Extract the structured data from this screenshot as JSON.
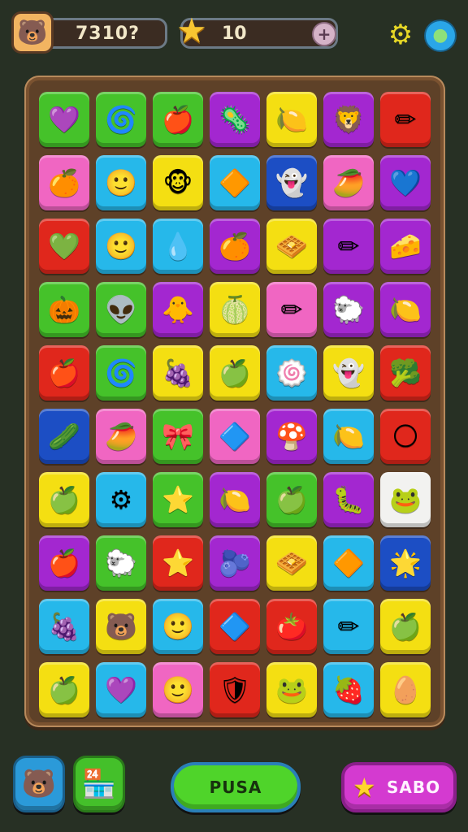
{
  "hud": {
    "score": "7310?",
    "stars": "10",
    "plus_label": "+",
    "avatar_icon": "bear-face-icon",
    "star_icon": "star-icon",
    "gear_icon": "gear-icon",
    "globe_icon": "globe-icon"
  },
  "board": {
    "rows": [
      [
        {
          "color": "green",
          "glyph": "💜"
        },
        {
          "color": "green",
          "glyph": "🌀"
        },
        {
          "color": "green",
          "glyph": "🍎"
        },
        {
          "color": "purple",
          "glyph": "🦠"
        },
        {
          "color": "yellow",
          "glyph": "🍋"
        },
        {
          "color": "purple",
          "glyph": "🦁"
        },
        {
          "color": "red",
          "glyph": "✏"
        }
      ],
      [
        {
          "color": "pink",
          "glyph": "🍊"
        },
        {
          "color": "cyan",
          "glyph": "🙂"
        },
        {
          "color": "yellow",
          "glyph": "🐵"
        },
        {
          "color": "cyan",
          "glyph": "🔶"
        },
        {
          "color": "blue",
          "glyph": "👻"
        },
        {
          "color": "pink",
          "glyph": "🥭"
        },
        {
          "color": "purple",
          "glyph": "💙"
        }
      ],
      [
        {
          "color": "red",
          "glyph": "💚"
        },
        {
          "color": "cyan",
          "glyph": "🙂"
        },
        {
          "color": "cyan",
          "glyph": "💧"
        },
        {
          "color": "purple",
          "glyph": "🍊"
        },
        {
          "color": "yellow",
          "glyph": "🧇"
        },
        {
          "color": "purple",
          "glyph": "✏"
        },
        {
          "color": "purple",
          "glyph": "🧀"
        }
      ],
      [
        {
          "color": "green",
          "glyph": "🎃"
        },
        {
          "color": "green",
          "glyph": "👽"
        },
        {
          "color": "purple",
          "glyph": "🐥"
        },
        {
          "color": "yellow",
          "glyph": "🍈"
        },
        {
          "color": "pink",
          "glyph": "✏"
        },
        {
          "color": "purple",
          "glyph": "🐑"
        },
        {
          "color": "purple",
          "glyph": "🍋"
        }
      ],
      [
        {
          "color": "red",
          "glyph": "🍎"
        },
        {
          "color": "green",
          "glyph": "🌀"
        },
        {
          "color": "yellow",
          "glyph": "🍇"
        },
        {
          "color": "yellow",
          "glyph": "🍏"
        },
        {
          "color": "cyan",
          "glyph": "🍥"
        },
        {
          "color": "yellow",
          "glyph": "👻"
        },
        {
          "color": "red",
          "glyph": "🥦"
        }
      ],
      [
        {
          "color": "blue",
          "glyph": "🥒"
        },
        {
          "color": "pink",
          "glyph": "🥭"
        },
        {
          "color": "green",
          "glyph": "🎀"
        },
        {
          "color": "pink",
          "glyph": "🔷"
        },
        {
          "color": "purple",
          "glyph": "🍄"
        },
        {
          "color": "cyan",
          "glyph": "🍋"
        },
        {
          "color": "red",
          "glyph": "🌕"
        }
      ],
      [
        {
          "color": "yellow",
          "glyph": "🍏"
        },
        {
          "color": "cyan",
          "glyph": "⚙"
        },
        {
          "color": "green",
          "glyph": "⭐"
        },
        {
          "color": "purple",
          "glyph": "🍋"
        },
        {
          "color": "green",
          "glyph": "🍏"
        },
        {
          "color": "purple",
          "glyph": "🐛"
        },
        {
          "color": "white",
          "glyph": "🐸"
        }
      ],
      [
        {
          "color": "purple",
          "glyph": "🍎"
        },
        {
          "color": "green",
          "glyph": "🐑"
        },
        {
          "color": "red",
          "glyph": "⭐"
        },
        {
          "color": "purple",
          "glyph": "🫐"
        },
        {
          "color": "yellow",
          "glyph": "🧇"
        },
        {
          "color": "cyan",
          "glyph": "🔶"
        },
        {
          "color": "blue",
          "glyph": "🌟"
        }
      ],
      [
        {
          "color": "cyan",
          "glyph": "🍇"
        },
        {
          "color": "yellow",
          "glyph": "🐻"
        },
        {
          "color": "cyan",
          "glyph": "🙂"
        },
        {
          "color": "red",
          "glyph": "🔷"
        },
        {
          "color": "red",
          "glyph": "🍅"
        },
        {
          "color": "cyan",
          "glyph": "✏"
        },
        {
          "color": "yellow",
          "glyph": "🍏"
        }
      ],
      [
        {
          "color": "yellow",
          "glyph": "🍏"
        },
        {
          "color": "cyan",
          "glyph": "💜"
        },
        {
          "color": "pink",
          "glyph": "🙂"
        },
        {
          "color": "red",
          "glyph": "🛡"
        },
        {
          "color": "yellow",
          "glyph": "🐸"
        },
        {
          "color": "cyan",
          "glyph": "🍓"
        },
        {
          "color": "yellow",
          "glyph": "🥚"
        }
      ]
    ]
  },
  "bottom": {
    "bear_icon": "bear-icon",
    "shop_icon": "shop-icon",
    "pusa_label": "PUSA",
    "sabo_label": "SABO",
    "sabo_icon": "star-icon"
  }
}
